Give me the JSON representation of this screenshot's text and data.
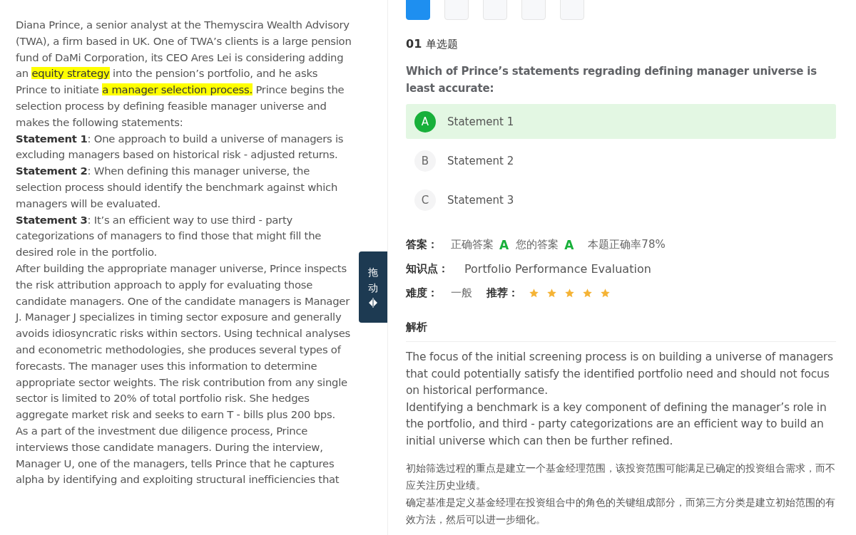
{
  "passage": [
    {
      "segments": [
        {
          "text": "Diana Prince, a senior analyst at the Themyscira Wealth Advisory (TWA), a firm based in UK. One of TWA’s clients is a large pension fund of DaMi Corporation, its CEO Ares Lei is considering adding an ",
          "highlighted": false
        },
        {
          "text": "equity strategy",
          "highlighted": true
        },
        {
          "text": " into the pension’s portfolio, and he asks Prince to initiate ",
          "highlighted": false
        },
        {
          "text": "a manager selection process.",
          "highlighted": true
        },
        {
          "text": " Prince begins the selection process by defining feasible manager universe and makes the following statements:",
          "highlighted": false
        }
      ]
    },
    {
      "segments": [
        {
          "text": "**Statement 1**: One approach to build a universe of managers is excluding managers based on historical risk - adjusted returns.",
          "highlighted": false
        }
      ]
    },
    {
      "segments": [
        {
          "text": "**Statement 2**: When defining this manager universe, the selection process should identify the benchmark against which managers will be evaluated.",
          "highlighted": false
        }
      ]
    },
    {
      "segments": [
        {
          "text": "**Statement 3**: It’s an efficient way to use third - party categorizations of managers to find those that might fill the desired role in the portfolio.",
          "highlighted": false
        }
      ]
    },
    {
      "segments": [
        {
          "text": "After building the appropriate manager universe, Prince inspects the risk attribution approach to apply for evaluating those candidate managers. One of the candidate managers is Manager J. Manager J specializes in timing sector exposure and generally avoids idiosyncratic risks within sectors. Using technical analyses and econometric methodologies, she produces several types of forecasts. The manager uses this information to determine appropriate sector weights. The risk contribution from any single sector is limited to 20% of total portfolio risk. She hedges aggregate market risk and seeks to earn T - bills plus 200 bps.",
          "highlighted": false
        }
      ]
    },
    {
      "segments": [
        {
          "text": "As a part of the investment due diligence process, Prince interviews those candidate managers. During the interview, Manager U, one of the managers, tells Prince that he captures alpha by identifying and exploiting structural inefficiencies that",
          "highlighted": false
        }
      ]
    }
  ],
  "drag_handle": {
    "chars": [
      "拖",
      "动"
    ]
  },
  "question_tabs": [
    {
      "selected": true
    },
    {
      "selected": false
    },
    {
      "selected": false
    },
    {
      "selected": false
    },
    {
      "selected": false
    }
  ],
  "question": {
    "number": "01",
    "type": "单选题",
    "text": "Which of Prince’s statements regrading defining manager universe is least accurate:"
  },
  "options": [
    {
      "letter": "A",
      "label": "Statement 1",
      "selected": true
    },
    {
      "letter": "B",
      "label": "Statement 2",
      "selected": false
    },
    {
      "letter": "C",
      "label": "Statement 3",
      "selected": false
    }
  ],
  "answer": {
    "label": "答案：",
    "correct_label": "正确答案",
    "correct": "A",
    "yours_label": "您的答案",
    "yours": "A",
    "rate": "本题正确率78%"
  },
  "knowledge": {
    "label": "知识点：",
    "value": "Portfolio Performance Evaluation"
  },
  "difficulty": {
    "label": "难度：",
    "value": "一般"
  },
  "recommend": {
    "label": "推荐：",
    "stars": 5
  },
  "analysis": {
    "title": "解析",
    "en": [
      "The focus of the initial screening process is on building a universe of managers that could potentially satisfy the identified portfolio need and should not focus on historical performance.",
      "Identifying a benchmark is a key component of defining the manager’s role in the portfolio, and third - party categorizations are an efficient way to build an initial universe which can then be further refined."
    ],
    "zh": [
      "初始筛选过程的重点是建立一个基金经理范围，该投资范围可能满足已确定的投资组合需求，而不应关注历史业绩。",
      "确定基准是定义基金经理在投资组合中的角色的关键组成部分，而第三方分类是建立初始范围的有效方法，然后可以进一步细化。"
    ]
  }
}
